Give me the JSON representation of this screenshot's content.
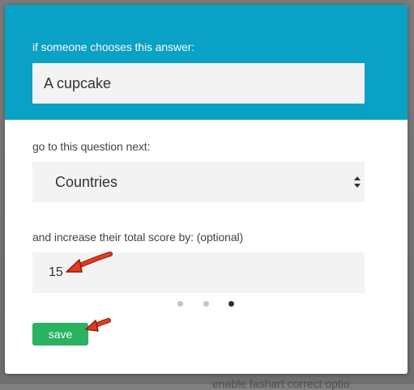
{
  "background": {
    "partial_text": "enable fashart correct optio"
  },
  "dialog": {
    "answer_label": "if someone chooses this answer:",
    "answer_value": "A cupcake",
    "next_question_label": "go to this question next:",
    "next_question_value": "Countries",
    "score_label": "and increase their total score by: (optional)",
    "score_value": "15",
    "save_label": "save",
    "pagination": {
      "total": 3,
      "current": 3
    }
  },
  "colors": {
    "header": "#0aa1c7",
    "save_button": "#27b35f",
    "annotation_arrow": "#e8391d"
  },
  "icons": {
    "select_arrows": "updown-arrows-icon",
    "annotation": "red-arrow-icon"
  }
}
